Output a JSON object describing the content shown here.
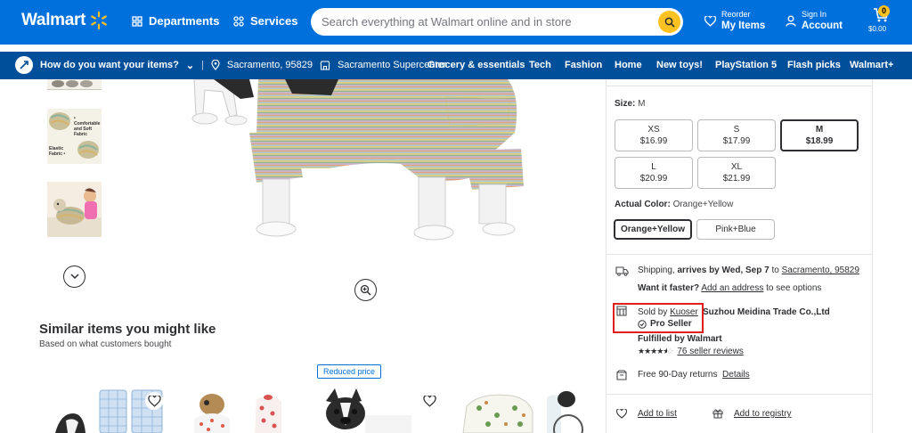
{
  "header": {
    "brand": "Walmart",
    "departments_label": "Departments",
    "services_label": "Services",
    "search_placeholder": "Search everything at Walmart online and in store",
    "reorder_small": "Reorder",
    "reorder_big": "My Items",
    "signin_small": "Sign In",
    "signin_big": "Account",
    "cart_count": "0",
    "cart_total": "$0.00",
    "colors": {
      "primary": "#0071dc",
      "spark": "#ffc220",
      "subnav": "#004f9a"
    }
  },
  "subnav": {
    "delivery_prompt": "How do you want your items?",
    "zip": "Sacramento, 95829",
    "store": "Sacramento Supercenter",
    "links": [
      "Grocery & essentials",
      "Tech",
      "Fashion",
      "Home",
      "New toys!",
      "PlayStation 5",
      "Flash picks",
      "Walmart+"
    ]
  },
  "gallery": {
    "thumb_caption_1": "• Comfortable and Soft Fabric",
    "thumb_caption_2": "Elastic Fabric •"
  },
  "similar": {
    "title": "Similar items you might like",
    "subtitle": "Based on what customers bought",
    "badge": "Reduced price"
  },
  "product": {
    "size_label": "Size:",
    "size_value": "M",
    "sizes": [
      {
        "name": "XS",
        "price": "$16.99"
      },
      {
        "name": "S",
        "price": "$17.99"
      },
      {
        "name": "M",
        "price": "$18.99"
      },
      {
        "name": "L",
        "price": "$20.99"
      },
      {
        "name": "XL",
        "price": "$21.99"
      }
    ],
    "color_label": "Actual Color:",
    "color_value": "Orange+Yellow",
    "colors": [
      "Orange+Yellow",
      "Pink+Blue"
    ],
    "shipping_prefix": "Shipping,",
    "shipping_arrival": "arrives by Wed, Sep 7",
    "shipping_to": "to",
    "shipping_location": "Sacramento, 95829",
    "faster_q": "Want it faster?",
    "faster_link": "Add an address",
    "faster_suffix": "to see options",
    "sold_by_prefix": "Sold by",
    "seller": "Kuoser",
    "seller_company": "Suzhou Meidina Trade Co.,Ltd",
    "pro_seller": "Pro Seller",
    "fulfilled": "Fulfilled by Walmart",
    "rating": 4.5,
    "reviews": "76 seller reviews",
    "returns": "Free 90-Day returns",
    "returns_link": "Details",
    "add_to_list": "Add to list",
    "add_to_registry": "Add to registry"
  }
}
